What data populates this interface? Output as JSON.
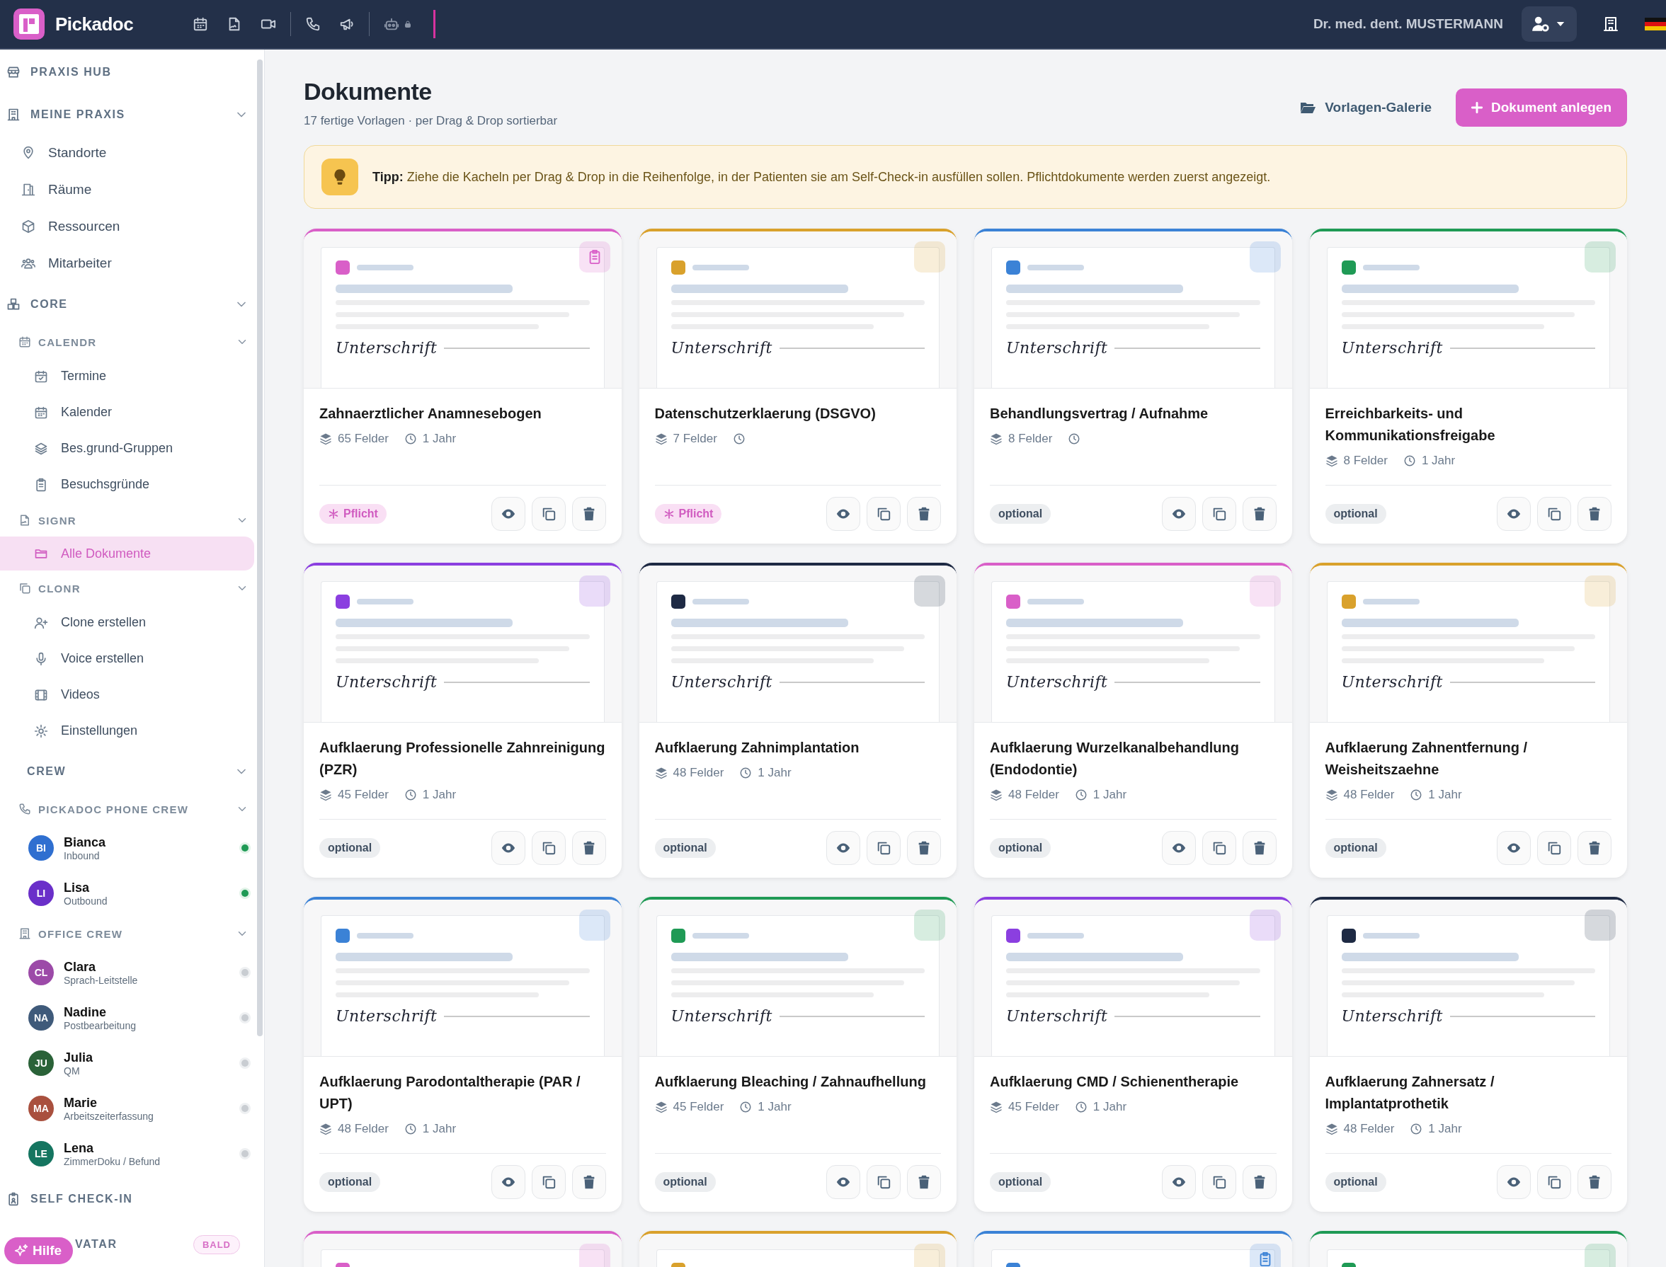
{
  "topbar": {
    "brand": "Pickadoc",
    "user_name": "Dr. med. dent. MUSTERMANN"
  },
  "sidebar": {
    "sections": [
      {
        "kind": "section",
        "label": "PRAXIS HUB"
      },
      {
        "kind": "section",
        "label": "MEINE PRAXIS",
        "expanded": true,
        "children": [
          {
            "kind": "link",
            "label": "Standorte",
            "selected": false
          },
          {
            "kind": "link",
            "label": "Räume",
            "selected": false
          },
          {
            "kind": "link",
            "label": "Ressourcen",
            "selected": false
          },
          {
            "kind": "link",
            "label": "Mitarbeiter",
            "selected": false
          }
        ]
      },
      {
        "kind": "section",
        "label": "CORE",
        "expanded": true,
        "children": [
          {
            "kind": "group",
            "label": "CALENDR",
            "expanded": true,
            "children": [
              {
                "kind": "link",
                "label": "Termine",
                "selected": false
              },
              {
                "kind": "link",
                "label": "Kalender",
                "selected": false
              },
              {
                "kind": "link",
                "label": "Bes.grund-Gruppen",
                "selected": false
              },
              {
                "kind": "link",
                "label": "Besuchsgründe",
                "selected": false
              }
            ]
          },
          {
            "kind": "group",
            "label": "SIGNR",
            "expanded": true,
            "children": [
              {
                "kind": "link",
                "label": "Alle Dokumente",
                "selected": true
              }
            ]
          },
          {
            "kind": "group",
            "label": "CLONR",
            "expanded": true,
            "children": [
              {
                "kind": "link",
                "label": "Clone erstellen",
                "selected": false
              },
              {
                "kind": "link",
                "label": "Voice erstellen",
                "selected": false
              },
              {
                "kind": "link",
                "label": "Videos",
                "selected": false
              },
              {
                "kind": "link",
                "label": "Einstellungen",
                "selected": false
              }
            ]
          }
        ]
      },
      {
        "kind": "section",
        "label": "CREW",
        "expanded": true,
        "children": [
          {
            "kind": "group",
            "label": "PICKADOC PHONE CREW",
            "expanded": true,
            "children": [
              {
                "kind": "person",
                "initials": "BI",
                "name": "Bianca",
                "role": "Inbound",
                "color": "#2f6fd0",
                "online": true
              },
              {
                "kind": "person",
                "initials": "LI",
                "name": "Lisa",
                "role": "Outbound",
                "color": "#6a2fc9",
                "online": true
              }
            ]
          },
          {
            "kind": "group",
            "label": "OFFICE CREW",
            "expanded": true,
            "children": [
              {
                "kind": "person",
                "initials": "CL",
                "name": "Clara",
                "role": "Sprach-Leitstelle",
                "color": "#9c4aa8",
                "online": false
              },
              {
                "kind": "person",
                "initials": "NA",
                "name": "Nadine",
                "role": "Postbearbeitung",
                "color": "#3f5a7a",
                "online": false
              },
              {
                "kind": "person",
                "initials": "JU",
                "name": "Julia",
                "role": "QM",
                "color": "#2a6238",
                "online": false
              },
              {
                "kind": "person",
                "initials": "MA",
                "name": "Marie",
                "role": "Arbeitszeiterfassung",
                "color": "#a9503e",
                "online": false
              },
              {
                "kind": "person",
                "initials": "LE",
                "name": "Lena",
                "role": "ZimmerDoku / Befund",
                "color": "#157560",
                "online": false
              }
            ]
          }
        ]
      },
      {
        "kind": "section",
        "label": "SELF CHECK-IN"
      },
      {
        "kind": "section",
        "label": "VATAR",
        "badge": "BALD"
      }
    ]
  },
  "help_button": "Hilfe",
  "page": {
    "title": "Dokumente",
    "subtitle": "17 fertige Vorlagen · per Drag & Drop sortierbar",
    "gallery_link": "Vorlagen-Galerie",
    "create_button": "Dokument anlegen",
    "tip": "**Tipp:** Ziehe die Kacheln per Drag & Drop in die Reihenfolge, in der Patienten sie am Self-Check-in ausfüllen sollen. Pflichtdokumente werden zuerst angezeigt."
  },
  "cards": [
    {
      "kind": "tile",
      "color": "#d95fc8",
      "corner_icon": true,
      "signature": "Unterschrift",
      "title": "Zahnaerztlicher Anamnesebogen",
      "fields": "65 Felder",
      "retention": "1 Jahr",
      "required": true,
      "badge": "Pflicht"
    },
    {
      "kind": "tile",
      "color": "#d9a12c",
      "corner_icon": false,
      "signature": "Unterschrift",
      "title": "Datenschutzerklaerung (DSGVO)",
      "fields": "7 Felder",
      "required": true,
      "badge": "Pflicht"
    },
    {
      "kind": "tile",
      "color": "#3b82d6",
      "corner_icon": false,
      "signature": "Unterschrift",
      "title": "Behandlungsvertrag / Aufnahme",
      "fields": "8 Felder",
      "required": false,
      "badge": "optional"
    },
    {
      "kind": "tile",
      "color": "#1f9a55",
      "corner_icon": false,
      "signature": "Unterschrift",
      "title": "Erreichbarkeits- und Kommunikationsfreigabe",
      "fields": "8 Felder",
      "retention": "1 Jahr",
      "required": false,
      "badge": "optional"
    },
    {
      "kind": "tile",
      "color": "#8b3fe0",
      "corner_icon": false,
      "signature": "Unterschrift",
      "title": "Aufklaerung Professionelle Zahnreinigung (PZR)",
      "fields": "45 Felder",
      "retention": "1 Jahr",
      "required": false,
      "badge": "optional"
    },
    {
      "kind": "tile",
      "color": "#1e2a44",
      "corner_icon": false,
      "signature": "Unterschrift",
      "title": "Aufklaerung Zahnimplantation",
      "fields": "48 Felder",
      "retention": "1 Jahr",
      "required": false,
      "badge": "optional"
    },
    {
      "kind": "tile",
      "color": "#d95fc8",
      "corner_icon": false,
      "signature": "Unterschrift",
      "title": "Aufklaerung Wurzelkanalbehandlung (Endodontie)",
      "fields": "48 Felder",
      "retention": "1 Jahr",
      "required": false,
      "badge": "optional"
    },
    {
      "kind": "tile",
      "color": "#d9a12c",
      "corner_icon": false,
      "signature": "Unterschrift",
      "title": "Aufklaerung Zahnentfernung / Weisheitszaehne",
      "fields": "48 Felder",
      "retention": "1 Jahr",
      "required": false,
      "badge": "optional"
    },
    {
      "kind": "tile",
      "color": "#3b82d6",
      "corner_icon": false,
      "signature": "Unterschrift",
      "title": "Aufklaerung Parodontaltherapie (PAR / UPT)",
      "fields": "48 Felder",
      "retention": "1 Jahr",
      "required": false,
      "badge": "optional"
    },
    {
      "kind": "tile",
      "color": "#1f9a55",
      "corner_icon": false,
      "signature": "Unterschrift",
      "title": "Aufklaerung Bleaching / Zahnaufhellung",
      "fields": "45 Felder",
      "retention": "1 Jahr",
      "required": false,
      "badge": "optional"
    },
    {
      "kind": "tile",
      "color": "#8b3fe0",
      "corner_icon": false,
      "signature": "Unterschrift",
      "title": "Aufklaerung CMD / Schienentherapie",
      "fields": "45 Felder",
      "retention": "1 Jahr",
      "required": false,
      "badge": "optional"
    },
    {
      "kind": "tile",
      "color": "#1e2a44",
      "corner_icon": false,
      "signature": "Unterschrift",
      "title": "Aufklaerung Zahnersatz / Implantatprothetik",
      "fields": "48 Felder",
      "retention": "1 Jahr",
      "required": false,
      "badge": "optional"
    },
    {
      "kind": "partial",
      "color": "#d95fc8",
      "corner_icon": false
    },
    {
      "kind": "partial",
      "color": "#d9a12c",
      "corner_icon": false
    },
    {
      "kind": "partial",
      "color": "#3b82d6",
      "corner_icon": true
    },
    {
      "kind": "partial",
      "color": "#1f9a55",
      "corner_icon": false
    }
  ]
}
